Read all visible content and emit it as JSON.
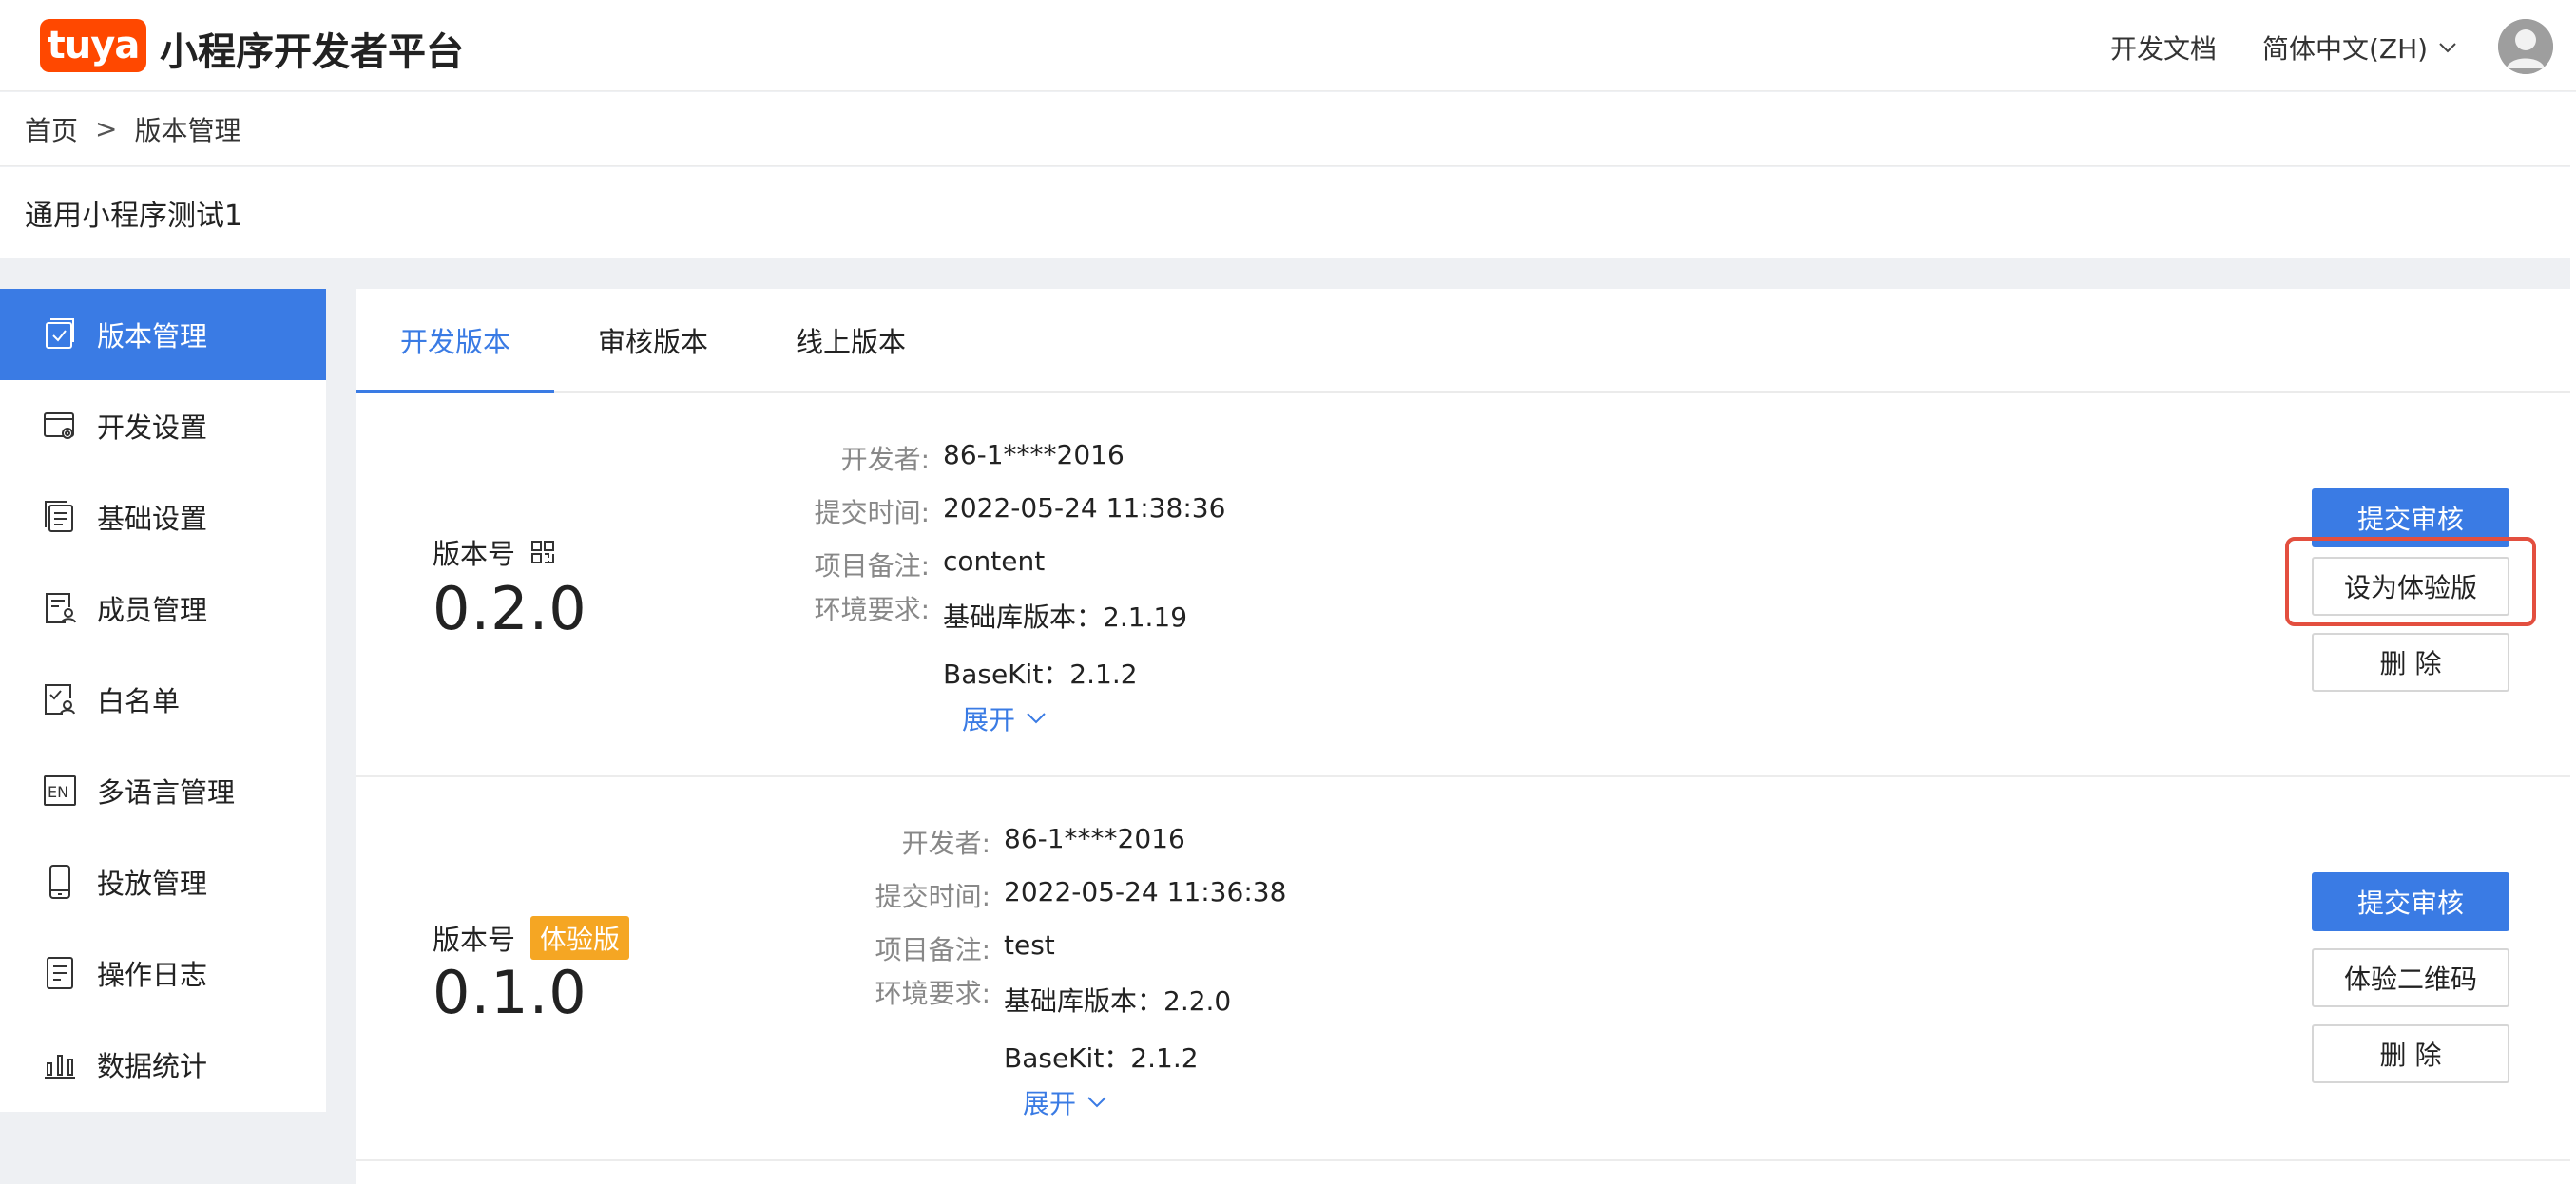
{
  "header": {
    "logo_text": "tuya",
    "platform_title": "小程序开发者平台",
    "docs_link": "开发文档",
    "language": "简体中文(ZH)"
  },
  "breadcrumb": {
    "home": "首页",
    "separator": ">",
    "current": "版本管理"
  },
  "app_name": "通用小程序测试1",
  "sidebar": {
    "items": [
      {
        "label": "版本管理",
        "icon": "version-icon",
        "active": true
      },
      {
        "label": "开发设置",
        "icon": "dev-settings-icon",
        "active": false
      },
      {
        "label": "基础设置",
        "icon": "basic-settings-icon",
        "active": false
      },
      {
        "label": "成员管理",
        "icon": "member-icon",
        "active": false
      },
      {
        "label": "白名单",
        "icon": "whitelist-icon",
        "active": false
      },
      {
        "label": "多语言管理",
        "icon": "language-icon",
        "active": false
      },
      {
        "label": "投放管理",
        "icon": "device-icon",
        "active": false
      },
      {
        "label": "操作日志",
        "icon": "log-icon",
        "active": false
      },
      {
        "label": "数据统计",
        "icon": "stats-icon",
        "active": false
      }
    ]
  },
  "tabs": [
    {
      "label": "开发版本",
      "active": true
    },
    {
      "label": "审核版本",
      "active": false
    },
    {
      "label": "线上版本",
      "active": false
    }
  ],
  "versions": [
    {
      "label": "版本号",
      "badge": "",
      "number": "0.2.0",
      "developer_key": "开发者:",
      "developer": "86-1****2016",
      "submit_time_key": "提交时间:",
      "submit_time": "2022-05-24 11:38:36",
      "remark_key": "项目备注:",
      "remark": "content",
      "env_key": "环境要求:",
      "env_base": "基础库版本：2.1.19",
      "env_basekit": "BaseKit：2.1.2",
      "expand": "展开",
      "btn_submit": "提交审核",
      "btn_second": "设为体验版",
      "btn_delete": "删 除"
    },
    {
      "label": "版本号",
      "badge": "体验版",
      "number": "0.1.0",
      "developer_key": "开发者:",
      "developer": "86-1****2016",
      "submit_time_key": "提交时间:",
      "submit_time": "2022-05-24 11:36:38",
      "remark_key": "项目备注:",
      "remark": "test",
      "env_key": "环境要求:",
      "env_base": "基础库版本：2.2.0",
      "env_basekit": "BaseKit：2.1.2",
      "expand": "展开",
      "btn_submit": "提交审核",
      "btn_second": "体验二维码",
      "btn_delete": "删 除"
    }
  ],
  "colors": {
    "primary": "#3a7be4",
    "brand": "#ff4800",
    "badge": "#f5a623",
    "highlight": "#e34f3f"
  }
}
